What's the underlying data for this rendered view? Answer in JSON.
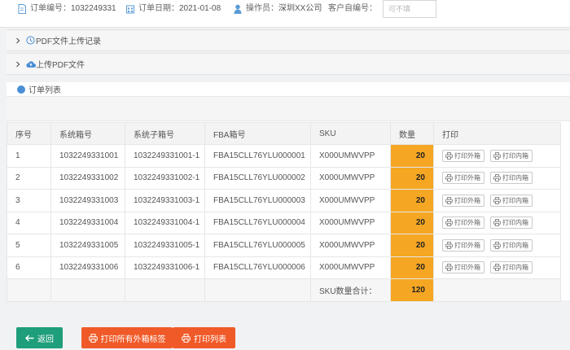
{
  "header": {
    "order_no_label": "订单编号：",
    "order_no_value": "1032249331",
    "order_date_label": "订单日期：",
    "order_date_value": "2021-01-08",
    "operator_label": "操作员：",
    "operator_value": "深圳XX公司",
    "customer_no_label": "客户自编号：",
    "customer_no_placeholder": "可不填"
  },
  "sections": {
    "upload_record": "PDF文件上传记录",
    "upload_pdf": "上传PDF文件",
    "order_list": "订单列表"
  },
  "table": {
    "columns": [
      "序号",
      "系统箱号",
      "系统子箱号",
      "FBA箱号",
      "SKU",
      "数量",
      "打印"
    ],
    "rows": [
      {
        "no": "1",
        "box": "1032249331001",
        "subbox": "1032249331001-1",
        "fba": "FBA15CLL76YLU000001",
        "sku": "X000UMWVPP",
        "qty": "20"
      },
      {
        "no": "2",
        "box": "1032249331002",
        "subbox": "1032249331002-1",
        "fba": "FBA15CLL76YLU000002",
        "sku": "X000UMWVPP",
        "qty": "20"
      },
      {
        "no": "3",
        "box": "1032249331003",
        "subbox": "1032249331003-1",
        "fba": "FBA15CLL76YLU000003",
        "sku": "X000UMWVPP",
        "qty": "20"
      },
      {
        "no": "4",
        "box": "1032249331004",
        "subbox": "1032249331004-1",
        "fba": "FBA15CLL76YLU000004",
        "sku": "X000UMWVPP",
        "qty": "20"
      },
      {
        "no": "5",
        "box": "1032249331005",
        "subbox": "1032249331005-1",
        "fba": "FBA15CLL76YLU000005",
        "sku": "X000UMWVPP",
        "qty": "20"
      },
      {
        "no": "6",
        "box": "1032249331006",
        "subbox": "1032249331006-1",
        "fba": "FBA15CLL76YLU000006",
        "sku": "X000UMWVPP",
        "qty": "20"
      }
    ],
    "print_outer_label": "打印外箱",
    "print_inner_label": "打印内箱",
    "total_label": "SKU数量合计：",
    "total_value": "120"
  },
  "buttons": {
    "back": "返回",
    "print_all_outer": "打印所有外箱标签",
    "print_list": "打印列表"
  },
  "colors": {
    "qty_highlight": "#f5a623",
    "back_button": "#1e9e7a",
    "print_button": "#f05a28"
  }
}
